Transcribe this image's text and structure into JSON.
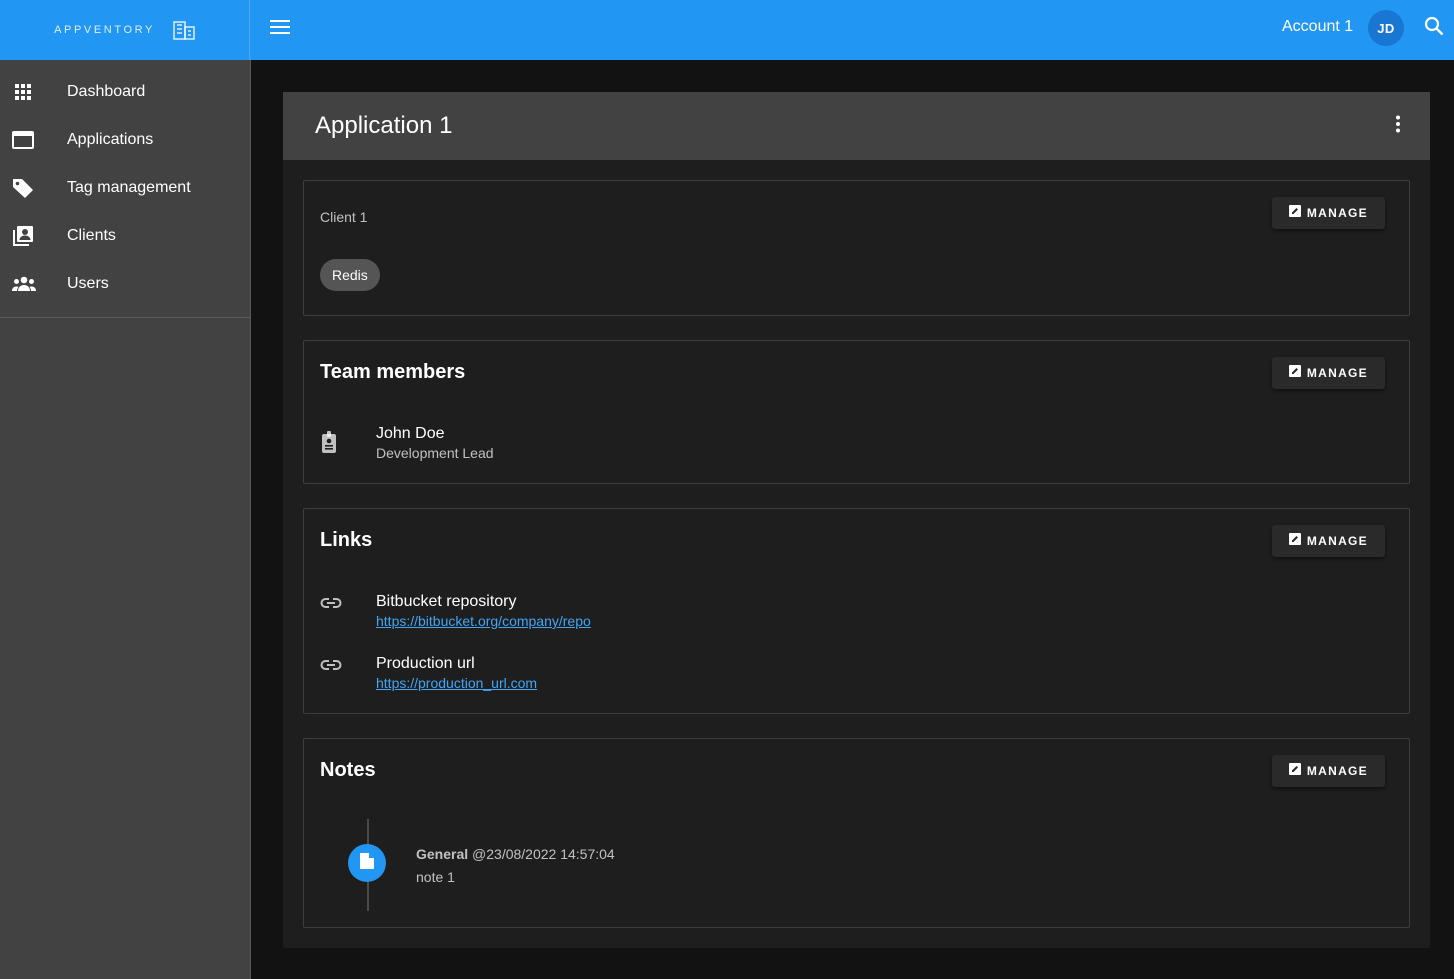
{
  "brand": {
    "name": "APPVENTORY",
    "icon": "building-icon"
  },
  "appbar": {
    "account_label": "Account 1",
    "avatar_initials": "JD",
    "menu_icon": "hamburger-menu-icon",
    "search_icon": "search-icon"
  },
  "sidebar": {
    "items": [
      {
        "label": "Dashboard",
        "icon": "apps-grid-icon"
      },
      {
        "label": "Applications",
        "icon": "window-icon"
      },
      {
        "label": "Tag management",
        "icon": "tag-icon"
      },
      {
        "label": "Clients",
        "icon": "contacts-icon"
      },
      {
        "label": "Users",
        "icon": "group-icon"
      }
    ]
  },
  "page": {
    "title": "Application 1"
  },
  "client_section": {
    "client_name": "Client 1",
    "chips": [
      "Redis"
    ],
    "manage_label": "MANAGE"
  },
  "team_section": {
    "title": "Team members",
    "manage_label": "MANAGE",
    "members": [
      {
        "name": "John Doe",
        "role": "Development Lead",
        "icon": "badge-icon"
      }
    ]
  },
  "links_section": {
    "title": "Links",
    "manage_label": "MANAGE",
    "links": [
      {
        "name": "Bitbucket repository",
        "url": "https://bitbucket.org/company/repo",
        "icon": "link-icon"
      },
      {
        "name": "Production url",
        "url": "https://production_url.com",
        "icon": "link-icon"
      }
    ]
  },
  "notes_section": {
    "title": "Notes",
    "manage_label": "MANAGE",
    "notes": [
      {
        "category": "General",
        "timestamp": "@23/08/2022 14:57:04",
        "text": "note 1",
        "icon": "note-icon"
      }
    ]
  },
  "colors": {
    "primary": "#2196f3",
    "avatar": "#1976d2",
    "link": "#42a5f5",
    "sidebar": "#424242",
    "card": "#1e1e1e",
    "background": "#121212"
  }
}
